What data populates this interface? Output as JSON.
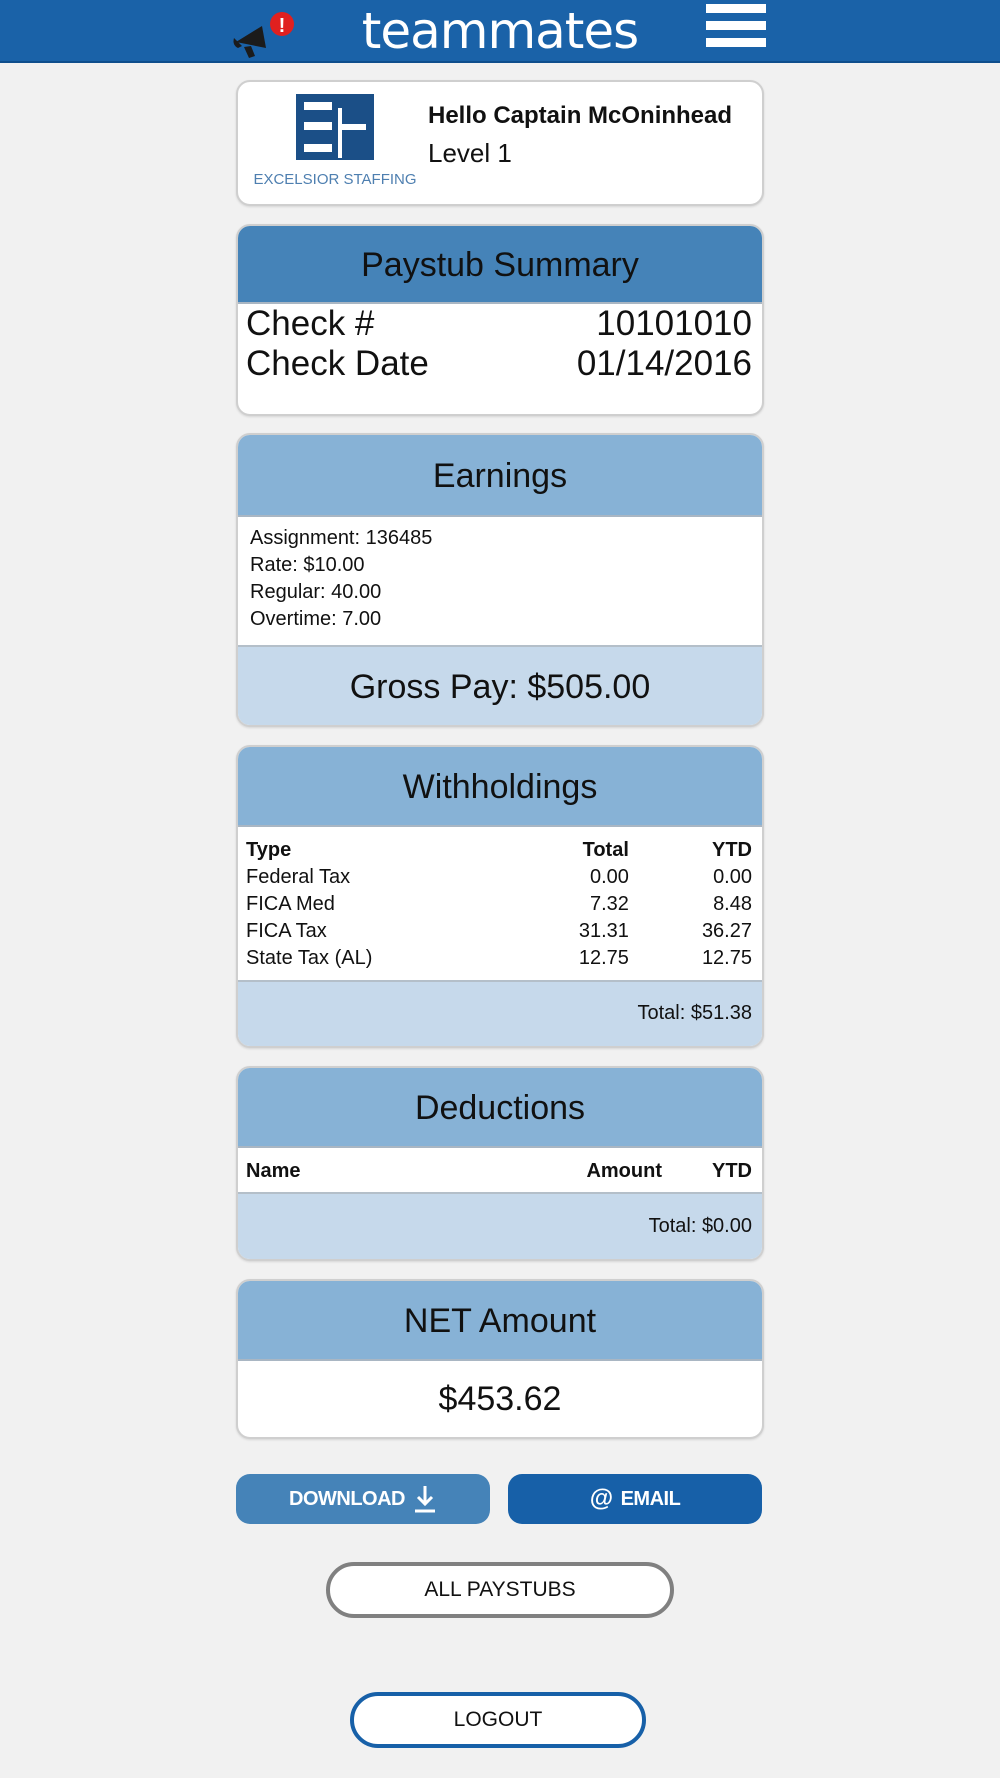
{
  "header": {
    "brand": "teammates",
    "notification_badge": "!"
  },
  "profile": {
    "company_logo_text": "EXCELSIOR STAFFING",
    "greeting": "Hello Captain McOninhead",
    "level": "Level 1"
  },
  "paystub_summary": {
    "title": "Paystub Summary",
    "check_number_label": "Check #",
    "check_number": "10101010",
    "check_date_label": "Check Date",
    "check_date": "01/14/2016"
  },
  "earnings": {
    "title": "Earnings",
    "lines": [
      "Assignment: 136485",
      "Rate: $10.00",
      "Regular: 40.00",
      "Overtime: 7.00"
    ],
    "gross_pay": "Gross Pay: $505.00"
  },
  "withholdings": {
    "title": "Withholdings",
    "columns": {
      "type": "Type",
      "total": "Total",
      "ytd": "YTD"
    },
    "rows": [
      {
        "type": "Federal Tax",
        "total": "0.00",
        "ytd": "0.00"
      },
      {
        "type": "FICA Med",
        "total": "7.32",
        "ytd": "8.48"
      },
      {
        "type": "FICA Tax",
        "total": "31.31",
        "ytd": "36.27"
      },
      {
        "type": "State Tax (AL)",
        "total": "12.75",
        "ytd": "12.75"
      }
    ],
    "total": "Total: $51.38"
  },
  "deductions": {
    "title": "Deductions",
    "columns": {
      "name": "Name",
      "amount": "Amount",
      "ytd": "YTD"
    },
    "total": "Total: $0.00"
  },
  "net_amount": {
    "title": "NET Amount",
    "value": "$453.62"
  },
  "actions": {
    "download_label": "DOWNLOAD",
    "email_label": "EMAIL",
    "all_paystubs_label": "ALL PAYSTUBS",
    "logout_label": "LOGOUT"
  },
  "icons": {
    "notification": "megaphone-icon",
    "menu": "hamburger-menu-icon",
    "download": "download-arrow-icon",
    "email": "at-sign-icon"
  },
  "colors": {
    "header_bg": "#1a62a8",
    "card_header_dark": "#4583b8",
    "card_header_light": "#87b2d6",
    "card_footer": "#c6d9eb",
    "badge": "#e0201f"
  }
}
